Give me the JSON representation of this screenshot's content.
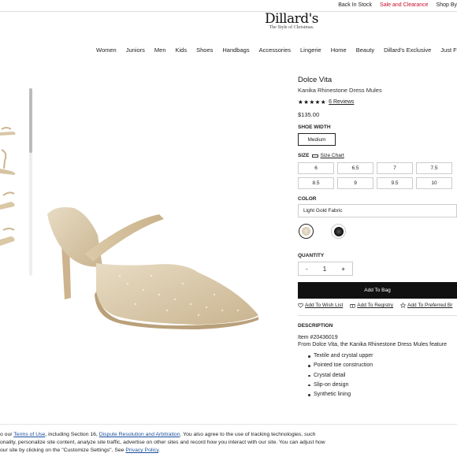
{
  "util_links": [
    "Back In Stock",
    "Sale and Clearance",
    "Shop By"
  ],
  "logo": {
    "brand": "Dillard's",
    "tagline": "The Style of Christmas."
  },
  "nav": [
    "Women",
    "Juniors",
    "Men",
    "Kids",
    "Shoes",
    "Handbags",
    "Accessories",
    "Lingerie",
    "Home",
    "Beauty",
    "Dillard's Exclusive",
    "Just Fo"
  ],
  "product": {
    "brand": "Dolce Vita",
    "name": "Kanika Rhinestone Dress Mules",
    "stars": "★★★★★",
    "reviews": "6 Reviews",
    "rating": 5,
    "price": "$135.00",
    "shoe_width_label": "SHOE WIDTH",
    "shoe_width_value": "Medium",
    "size_label": "SIZE",
    "size_chart": "Size Chart",
    "sizes": [
      "6",
      "6.5",
      "7",
      "7.5",
      "8.5",
      "9",
      "9.5",
      "10"
    ],
    "color_label": "COLOR",
    "color_value": "Light Gold Fabric",
    "quantity_label": "QUANTITY",
    "quantity": "1",
    "qty_minus": "-",
    "qty_plus": "+",
    "add_to_bag": "Add To Bag",
    "wish_list": "Add To Wish List",
    "registry": "Add To Registry",
    "preferred": "Add To Preferred Br",
    "description_label": "DESCRIPTION",
    "item_number": "Item #20436019",
    "intro": "From Dolce Vita, the Kanika Rhinestone Dress Mules feature",
    "bullets": [
      "Textile and crystal upper",
      "Pointed toe construction",
      "Crystal detail",
      "Slip-on design",
      "Synthetic lining"
    ]
  },
  "cookie": {
    "l1a": "o our",
    "terms": "Terms of Use",
    "l1b": ", including Section 16,",
    "dispute": "Dispute Resolution and Arbitration",
    "l1c": ". You also agree to the use of tracking technologies, such",
    "l2": "onality, personalize site content, analyze site traffic, advertise on other sites and record how you interact with our site. You can adjust how",
    "l3": "our site by clicking on the \"Customize Settings\". See",
    "privacy": "Privacy Policy",
    "l3end": "."
  }
}
